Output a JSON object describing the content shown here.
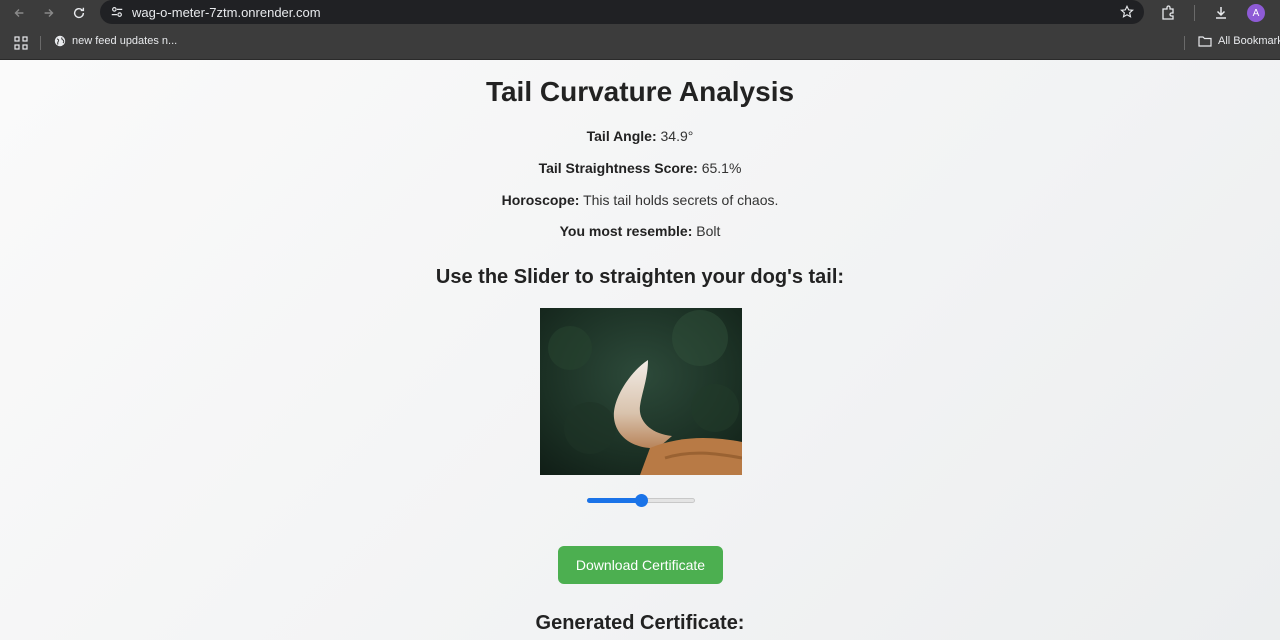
{
  "browser": {
    "url": "wag-o-meter-7ztm.onrender.com",
    "bookmark": "new feed updates n...",
    "all_bookmarks": "All Bookmarks",
    "avatar_letter": "A"
  },
  "page": {
    "title": "Tail Curvature Analysis",
    "stats": [
      {
        "label": "Tail Angle:",
        "value": "34.9°"
      },
      {
        "label": "Tail Straightness Score:",
        "value": "65.1%"
      },
      {
        "label": "Horoscope:",
        "value": "This tail holds secrets of chaos."
      },
      {
        "label": "You most resemble:",
        "value": "Bolt"
      }
    ],
    "slider_heading": "Use the Slider to straighten your dog's tail:",
    "slider_value_fraction": 0.5,
    "download_button": "Download Certificate",
    "certificate_heading": "Generated Certificate:"
  },
  "colors": {
    "accent": "#1a73e8",
    "button": "#4caf50",
    "chrome": "#3c3c3c"
  }
}
